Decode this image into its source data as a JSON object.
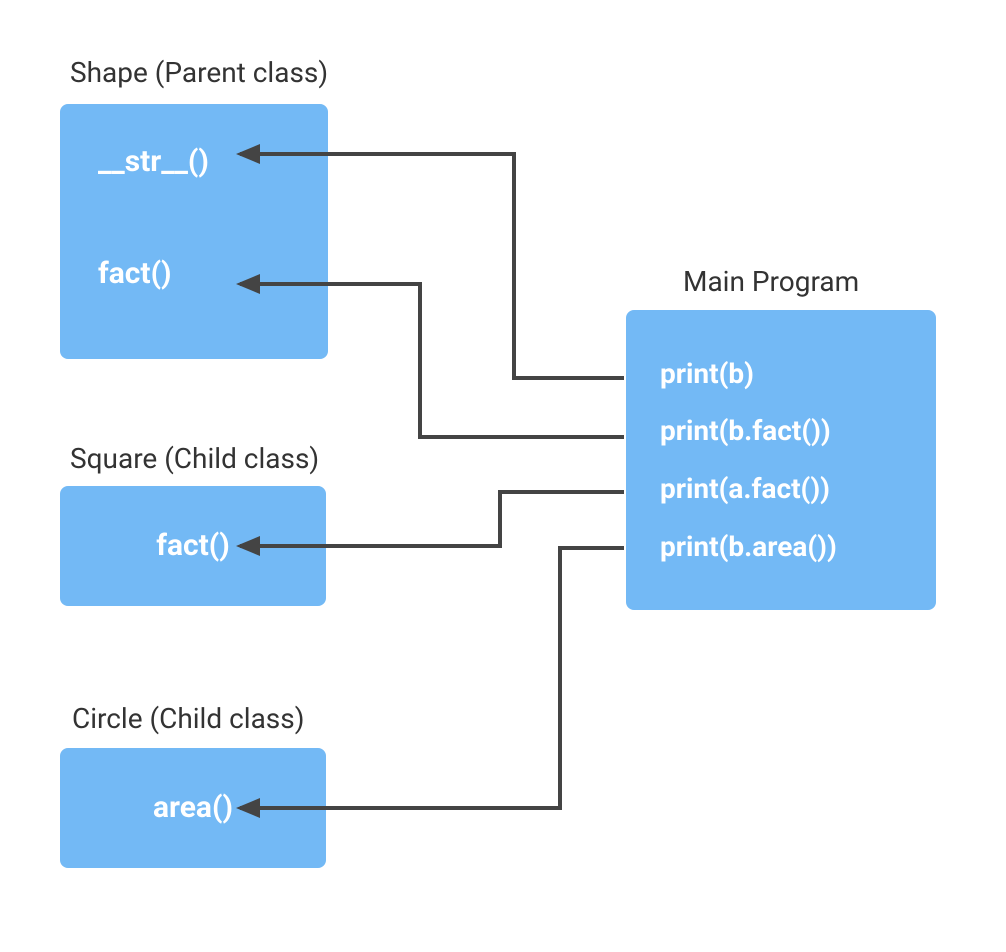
{
  "shape": {
    "label": "Shape (Parent class)",
    "methods": {
      "str": "__str__()",
      "fact": "fact()"
    }
  },
  "square": {
    "label": "Square (Child class)",
    "methods": {
      "fact": "fact()"
    }
  },
  "circle": {
    "label": "Circle (Child class)",
    "methods": {
      "area": "area()"
    }
  },
  "main": {
    "label": "Main Program",
    "lines": {
      "print_b": "print(b)",
      "print_b_fact": "print(b.fact())",
      "print_a_fact": "print(a.fact())",
      "print_b_area": "print(b.area())"
    }
  },
  "arrows": [
    {
      "from": "main.print_b",
      "to": "shape.__str__"
    },
    {
      "from": "main.print_b_fact",
      "to": "shape.fact"
    },
    {
      "from": "main.print_a_fact",
      "to": "square.fact"
    },
    {
      "from": "main.print_b_area",
      "to": "circle.area"
    }
  ],
  "colors": {
    "box": "#73B9F5",
    "text": "#333333",
    "connector": "#444444"
  }
}
